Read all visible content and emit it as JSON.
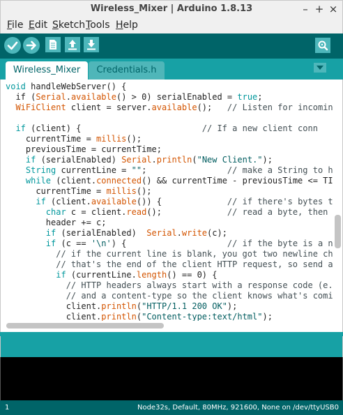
{
  "window": {
    "title": "Wireless_Mixer | Arduino 1.8.13",
    "minimize": "–",
    "maximize": "+",
    "close": "×"
  },
  "menu": [
    {
      "first": "F",
      "rest": "ile"
    },
    {
      "first": "E",
      "rest": "dit"
    },
    {
      "first": "S",
      "rest": "ketch"
    },
    {
      "first": "T",
      "rest": "ools"
    },
    {
      "first": "H",
      "rest": "elp"
    }
  ],
  "toolbar": {
    "icons": [
      "verify-icon",
      "upload-icon",
      "new-icon",
      "open-icon",
      "save-icon",
      "serial-monitor-icon"
    ]
  },
  "tabs": [
    {
      "label": "Wireless_Mixer",
      "active": true
    },
    {
      "label": "Credentials.h",
      "active": false
    }
  ],
  "tab_menu_icon": "chevron-down-icon",
  "code_lines": [
    [
      {
        "x": "void",
        "c": "k"
      },
      {
        "x": " handleWebServer() {"
      }
    ],
    [
      {
        "x": "  if ("
      },
      {
        "x": "Serial",
        "c": "t"
      },
      {
        "x": "."
      },
      {
        "x": "available",
        "c": "t"
      },
      {
        "x": "() > 0) serialEnabled = "
      },
      {
        "x": "true",
        "c": "k"
      },
      {
        "x": ";"
      }
    ],
    [
      {
        "x": "  "
      },
      {
        "x": "WiFiClient",
        "c": "t"
      },
      {
        "x": " client = server."
      },
      {
        "x": "available",
        "c": "t"
      },
      {
        "x": "();   "
      },
      {
        "x": "// Listen for incoming",
        "c": "c"
      }
    ],
    [
      {
        "x": ""
      }
    ],
    [
      {
        "x": "  "
      },
      {
        "x": "if",
        "c": "k"
      },
      {
        "x": " (client) {                        "
      },
      {
        "x": "// If a new client conn",
        "c": "c"
      }
    ],
    [
      {
        "x": "    currentTime = "
      },
      {
        "x": "millis",
        "c": "t"
      },
      {
        "x": "();"
      }
    ],
    [
      {
        "x": "    previousTime = currentTime;"
      }
    ],
    [
      {
        "x": "    "
      },
      {
        "x": "if",
        "c": "k"
      },
      {
        "x": " (serialEnabled) "
      },
      {
        "x": "Serial",
        "c": "t"
      },
      {
        "x": "."
      },
      {
        "x": "println",
        "c": "t"
      },
      {
        "x": "("
      },
      {
        "x": "\"New Client.\"",
        "c": "s"
      },
      {
        "x": ");"
      }
    ],
    [
      {
        "x": "    "
      },
      {
        "x": "String",
        "c": "k"
      },
      {
        "x": " currentLine = "
      },
      {
        "x": "\"\"",
        "c": "s"
      },
      {
        "x": ";                "
      },
      {
        "x": "// make a String to hol",
        "c": "c"
      }
    ],
    [
      {
        "x": "    "
      },
      {
        "x": "while",
        "c": "k"
      },
      {
        "x": " (client."
      },
      {
        "x": "connected",
        "c": "t"
      },
      {
        "x": "() && currentTime - previousTime <= TIME"
      }
    ],
    [
      {
        "x": "      currentTime = "
      },
      {
        "x": "millis",
        "c": "t"
      },
      {
        "x": "();"
      }
    ],
    [
      {
        "x": "      "
      },
      {
        "x": "if",
        "c": "k"
      },
      {
        "x": " (client."
      },
      {
        "x": "available",
        "c": "t"
      },
      {
        "x": "()) {             "
      },
      {
        "x": "// if there's bytes to",
        "c": "c"
      }
    ],
    [
      {
        "x": "        "
      },
      {
        "x": "char",
        "c": "k"
      },
      {
        "x": " c = client."
      },
      {
        "x": "read",
        "c": "t"
      },
      {
        "x": "();             "
      },
      {
        "x": "// read a byte, then",
        "c": "c"
      }
    ],
    [
      {
        "x": "        header += c;"
      }
    ],
    [
      {
        "x": "        "
      },
      {
        "x": "if",
        "c": "k"
      },
      {
        "x": " (serialEnabled)  "
      },
      {
        "x": "Serial",
        "c": "t"
      },
      {
        "x": "."
      },
      {
        "x": "write",
        "c": "t"
      },
      {
        "x": "(c);"
      }
    ],
    [
      {
        "x": "        "
      },
      {
        "x": "if",
        "c": "k"
      },
      {
        "x": " (c == "
      },
      {
        "x": "'\\n'",
        "c": "s"
      },
      {
        "x": ") {                    "
      },
      {
        "x": "// if the byte is a new",
        "c": "c"
      }
    ],
    [
      {
        "x": "          "
      },
      {
        "x": "// if the current line is blank, you got two newline char",
        "c": "c"
      }
    ],
    [
      {
        "x": "          "
      },
      {
        "x": "// that's the end of the client HTTP request, so send a r",
        "c": "c"
      }
    ],
    [
      {
        "x": "          "
      },
      {
        "x": "if",
        "c": "k"
      },
      {
        "x": " (currentLine."
      },
      {
        "x": "length",
        "c": "t"
      },
      {
        "x": "() == 0) {"
      }
    ],
    [
      {
        "x": "            "
      },
      {
        "x": "// HTTP headers always start with a response code (e.g.",
        "c": "c"
      }
    ],
    [
      {
        "x": "            "
      },
      {
        "x": "// and a content-type so the client knows what's coming",
        "c": "c"
      }
    ],
    [
      {
        "x": "            client."
      },
      {
        "x": "println",
        "c": "t"
      },
      {
        "x": "("
      },
      {
        "x": "\"HTTP/1.1 200 OK\"",
        "c": "s"
      },
      {
        "x": ");"
      }
    ],
    [
      {
        "x": "            client."
      },
      {
        "x": "println",
        "c": "t"
      },
      {
        "x": "("
      },
      {
        "x": "\"Content-type:text/html\"",
        "c": "s"
      },
      {
        "x": ");"
      }
    ]
  ],
  "colors": {
    "toolbar": "#006468",
    "tabbar": "#17a1a5",
    "keyword": "#00979c",
    "type": "#d35400",
    "comment": "#434f54",
    "string": "#005c5f",
    "console": "#000000"
  },
  "status": {
    "line": "1",
    "board": "Node32s, Default, 80MHz, 921600, None on /dev/ttyUSB0"
  }
}
